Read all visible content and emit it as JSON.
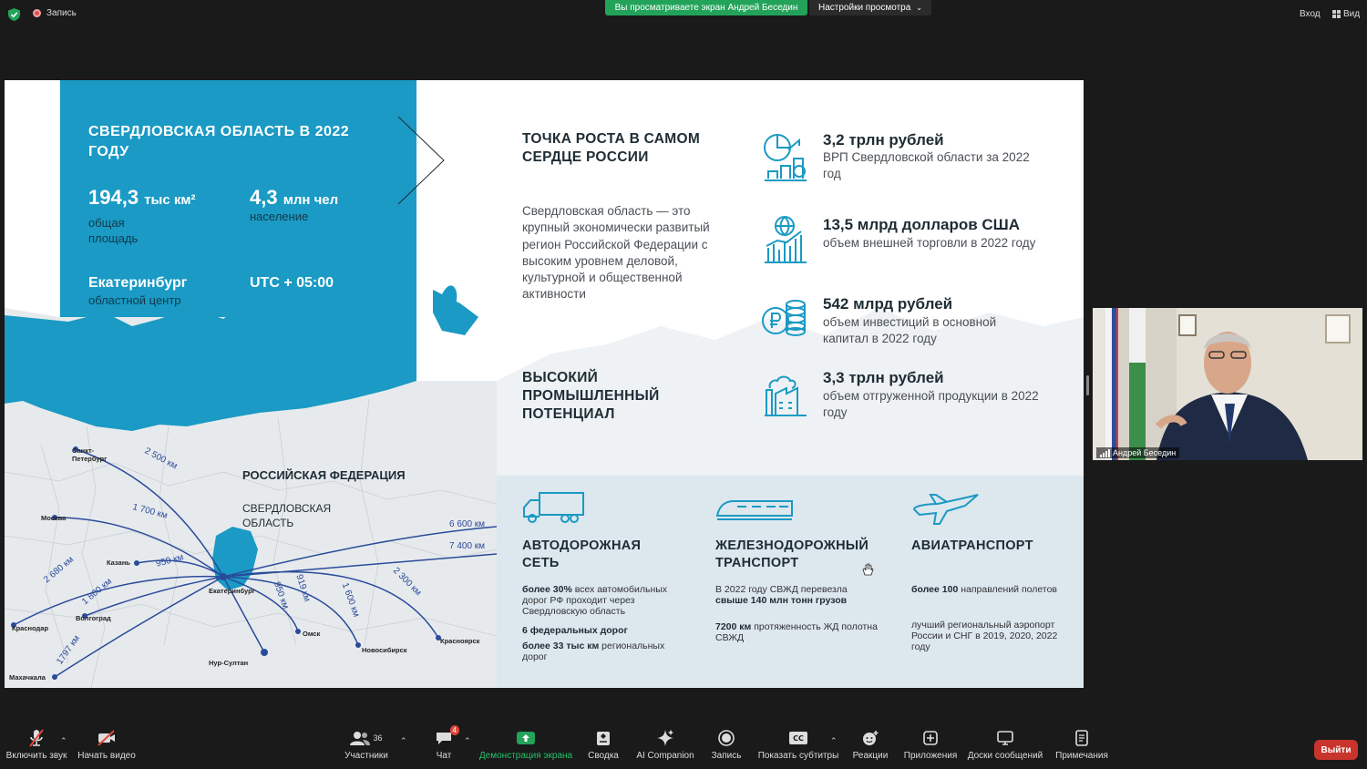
{
  "topbar": {
    "record_label": "Запись",
    "viewing_banner": "Вы просматриваете экран Андрей Беседин",
    "view_settings": "Настройки просмотра",
    "enter_label": "Вход",
    "view_label": "Вид"
  },
  "slide": {
    "region_title": "СВЕРДЛОВСКАЯ ОБЛАСТЬ В 2022 ГОДУ",
    "area_value": "194,3",
    "area_unit": "тыс км²",
    "area_caption": "общая площадь",
    "population_value": "4,3",
    "population_unit": "млн чел",
    "population_caption": "население",
    "center_city": "Екатеринбург",
    "center_caption": "областной центр",
    "timezone": "UTC + 05:00",
    "growth_title": "ТОЧКА РОСТА В САМОМ СЕРДЦЕ РОССИИ",
    "growth_text": "Свердловская область — это крупный экономически развитый регион Российской Федерации с высоким уровнем деловой, культурной и общественной активности",
    "industry_title": "ВЫСОКИЙ ПРОМЫШЛЕННЫЙ ПОТЕНЦИАЛ",
    "stats": [
      {
        "value": "3,2 трлн рублей",
        "desc": "ВРП Свердловской области за 2022 год",
        "icon": "pie-chart-growth-icon"
      },
      {
        "value": "13,5 млрд долларов США",
        "desc": "объем внешней торговли в 2022 году",
        "icon": "globe-trade-icon"
      },
      {
        "value": "542 млрд рублей",
        "desc": "объем инвестиций в основной капитал в 2022 году",
        "icon": "coins-icon"
      },
      {
        "value": "3,3 трлн рублей",
        "desc": "объем отгруженной продукции в 2022 году",
        "icon": "factory-icon"
      }
    ],
    "transport": [
      {
        "title": "АВТОДОРОЖНАЯ СЕТЬ",
        "icon": "truck-icon",
        "lines": [
          {
            "bold": "более 30%",
            "text": " всех автомобильных дорог РФ проходит через Свердловскую область"
          },
          {
            "bold": "6 федеральных дорог",
            "text": ""
          },
          {
            "bold": "более 33 тыс км",
            "text": " региональных дорог"
          }
        ]
      },
      {
        "title": "ЖЕЛЕЗНОДОРОЖНЫЙ ТРАНСПОРТ",
        "icon": "train-icon",
        "lines": [
          {
            "bold": "",
            "text": "В 2022 году СВЖД перевезла "
          },
          {
            "bold": "свыше 140 млн тонн грузов",
            "text": ""
          },
          {
            "bold": "7200 км",
            "text": " протяженность ЖД полотна СВЖД"
          }
        ]
      },
      {
        "title": "АВИАТРАНСПОРТ",
        "icon": "airplane-icon",
        "lines": [
          {
            "bold": "более 100",
            "text": " направлений полетов"
          },
          {
            "bold": "",
            "text": "лучший региональный аэропорт России и СНГ в 2019, 2020, 2022 году"
          }
        ]
      }
    ],
    "map": {
      "country": "РОССИЙСКАЯ ФЕДЕРАЦИЯ",
      "region": "СВЕРДЛОВСКАЯ ОБЛАСТЬ",
      "cities": [
        "Санкт-Петербург",
        "Москва",
        "Казань",
        "Краснодар",
        "Волгоград",
        "Махачкала",
        "Нур-Султан",
        "Омск",
        "Новосибирск",
        "Красноярск",
        "Екатеринбург"
      ],
      "distances": [
        "2 500 км",
        "1 700 км",
        "950 км",
        "2 680 км",
        "1 800 км",
        "1797 км",
        "950 км",
        "919 км",
        "1 600 км",
        "2 300 км",
        "6 600 км",
        "7 400 км"
      ]
    }
  },
  "participant": {
    "name": "Андрей Беседин"
  },
  "toolbar": {
    "mute": "Включить звук",
    "video": "Начать видео",
    "participants": "Участники",
    "participants_count": "36",
    "chat": "Чат",
    "chat_badge": "4",
    "share": "Демонстрация экрана",
    "summary": "Сводка",
    "ai": "AI Companion",
    "record": "Запись",
    "captions": "Показать субтитры",
    "reactions": "Реакции",
    "apps": "Приложения",
    "whiteboards": "Доски сообщений",
    "notes": "Примечания",
    "leave": "Выйти"
  },
  "colors": {
    "slide_blue": "#1a9ac4",
    "share_green": "#23a35a",
    "leave_red": "#c8342c"
  }
}
